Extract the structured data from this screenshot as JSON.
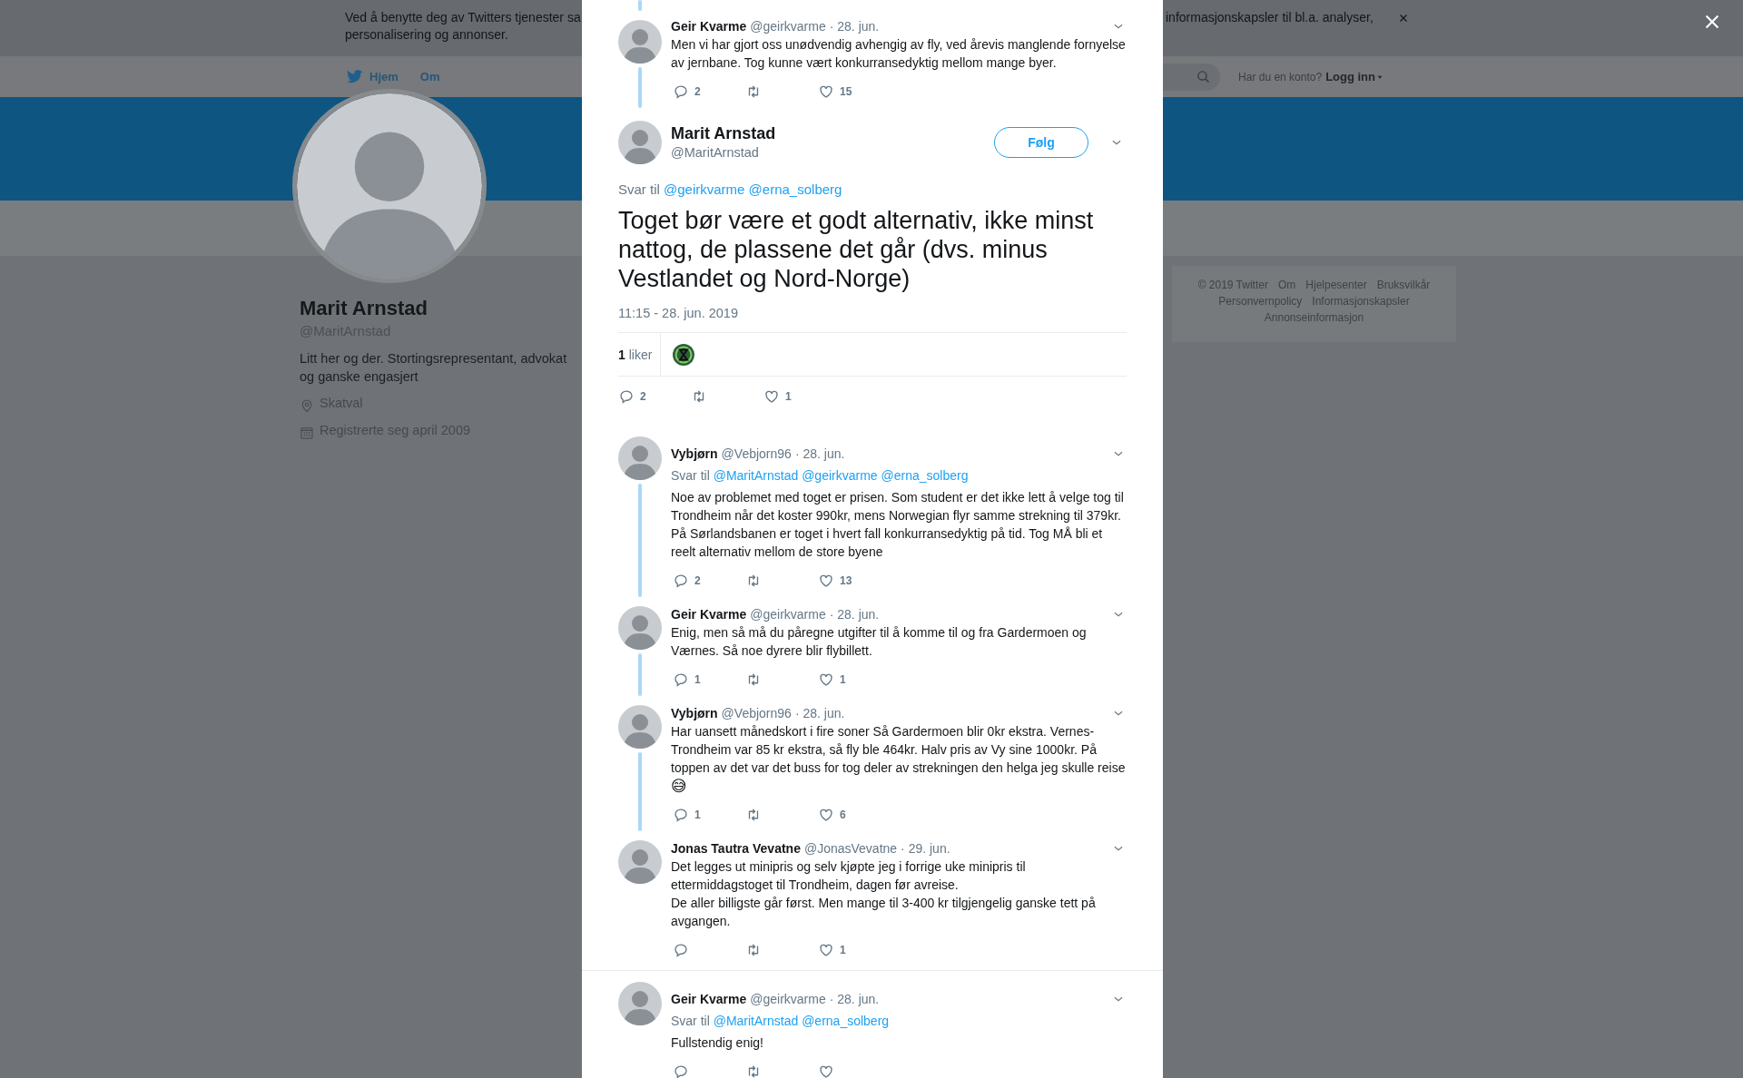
{
  "cookie_banner": {
    "line_1_start": "Ved å benytte deg av Twitters tjenester sa",
    "line_1_end": "informasjonskapsler til bl.a. analyser,",
    "line_2": "personalisering og annonser."
  },
  "nav": {
    "items": [
      {
        "label": "Hjem"
      },
      {
        "label": "Om"
      }
    ],
    "login_prompt": "Har du en konto?",
    "login_link": "Logg inn"
  },
  "profile": {
    "name": "Marit Arnstad",
    "handle": "@MaritArnstad",
    "bio": "Litt her og der. Stortingsrepresentant, advokat og ganske engasjert",
    "location": "Skatval",
    "joined": "Registrerte seg april 2009"
  },
  "footer": {
    "copyright": "© 2019 Twitter",
    "links": [
      "Om",
      "Hjelpesenter",
      "Bruksvilkår",
      "Personvernpolicy",
      "Informasjonskapsler",
      "Annonseinformasjon"
    ]
  },
  "modal": {
    "parent_tweet": {
      "name": "Geir Kvarme",
      "handle": "@geirkvarme",
      "date": "· 28. jun.",
      "text": "Men vi har gjort oss unødvendig avhengig av fly, ved årevis manglende fornyelse av jernbane. Tog kunne vært konkurransedyktig mellom mange byer.",
      "replies": "2",
      "likes": "15"
    },
    "main_tweet": {
      "name": "Marit Arnstad",
      "handle": "@MaritArnstad",
      "follow_button": "Følg",
      "reply_label": "Svar til",
      "reply_to": [
        "@geirkvarme",
        "@erna_solberg"
      ],
      "text": "Toget bør være et godt alternativ, ikke minst nattog, de plassene det går (dvs. minus Vestlandet og Nord-Norge)",
      "timestamp": "11:15 - 28. jun. 2019",
      "likes_summary": "**1** liker",
      "replies": "2",
      "likes": "1"
    },
    "conversations": [
      [
        {
          "name": "Vybjørn",
          "handle": "@Vebjorn96",
          "date": "· 28. jun.",
          "reply_label": "Svar til",
          "reply_to": [
            "@MaritArnstad",
            "@geirkvarme",
            "@erna_solberg"
          ],
          "text": "Noe av problemet med toget er prisen. Som student er det ikke lett å velge tog til Trondheim når det koster 990kr, mens Norwegian flyr samme strekning til 379kr. På Sørlandsbanen er toget i hvert fall konkurransedyktig på tid. Tog MÅ bli et reelt alternativ mellom de store byene",
          "replies": "2",
          "likes": "13"
        },
        {
          "name": "Geir Kvarme",
          "handle": "@geirkvarme",
          "date": "· 28. jun.",
          "text": "Enig, men så må du påregne utgifter til å komme til og fra Gardermoen og Værnes. Så noe dyrere blir flybillett.",
          "replies": "1",
          "likes": "1"
        },
        {
          "name": "Vybjørn",
          "handle": "@Vebjorn96",
          "date": "· 28. jun.",
          "text": "Har uansett månedskort i fire soner Så Gardermoen blir 0kr ekstra. Vernes-Trondheim var 85 kr ekstra, så fly ble 464kr. Halv pris av Vy sine 1000kr. På toppen av det var det buss for tog deler av strekningen den helga jeg skulle reise",
          "emoji": "😅",
          "replies": "1",
          "likes": "6"
        },
        {
          "name": "Jonas Tautra Vevatne",
          "handle": "@JonasVevatne",
          "date": "· 29. jun.",
          "text": "Det legges ut minipris og selv kjøpte jeg i forrige uke minipris til ettermiddagstoget til Trondheim, dagen før avreise.\nDe aller billigste går først. Men mange til 3-400 kr tilgjengelig ganske tett på avgangen.",
          "likes": "1"
        }
      ],
      [
        {
          "name": "Geir Kvarme",
          "handle": "@geirkvarme",
          "date": "· 28. jun.",
          "reply_label": "Svar til",
          "reply_to": [
            "@MaritArnstad",
            "@erna_solberg"
          ],
          "text": "Fullstendig enig!"
        }
      ]
    ]
  }
}
